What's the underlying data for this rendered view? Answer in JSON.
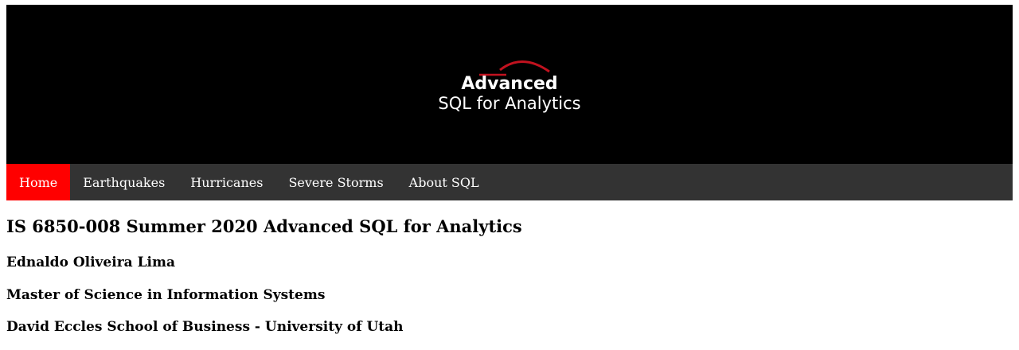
{
  "banner": {
    "logo_line1": "Advanced",
    "logo_line2": "SQL for Analytics",
    "roof_color": "#c1121f"
  },
  "nav": {
    "items": [
      {
        "label": "Home",
        "active": true
      },
      {
        "label": "Earthquakes",
        "active": false
      },
      {
        "label": "Hurricanes",
        "active": false
      },
      {
        "label": "Severe Storms",
        "active": false
      },
      {
        "label": "About SQL",
        "active": false
      }
    ],
    "active_color": "#ff0000",
    "bar_color": "#333333"
  },
  "content": {
    "title": "IS 6850-008 Summer 2020 Advanced SQL for Analytics",
    "name": "Ednaldo Oliveira Lima",
    "program": "Master of Science in Information Systems",
    "school": "David Eccles School of Business - University of Utah"
  }
}
